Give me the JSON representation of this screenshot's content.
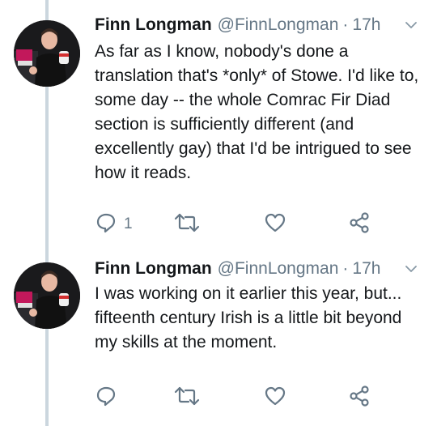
{
  "tweets": [
    {
      "author_name": "Finn Longman",
      "handle": "@FinnLongman",
      "separator": "·",
      "time": "17h",
      "text": "As far as I know, nobody's done a translation that's *only* of Stowe. I'd like to, some day -- the whole Comrac Fir Diad section is sufficiently different (and excellently gay) that I'd be intrigued to see how it reads.",
      "reply_count": "1"
    },
    {
      "author_name": "Finn Longman",
      "handle": "@FinnLongman",
      "separator": "·",
      "time": "17h",
      "text": "I was working on it earlier this year, but... fifteenth century Irish is a little bit beyond my skills at the moment.",
      "reply_count": ""
    }
  ],
  "icons": {
    "reply": "reply-icon",
    "retweet": "retweet-icon",
    "like": "heart-icon",
    "share": "share-icon",
    "more": "chevron-down-icon"
  },
  "colors": {
    "text": "#14171a",
    "secondary": "#657786",
    "thread_line": "#cbd6de"
  }
}
